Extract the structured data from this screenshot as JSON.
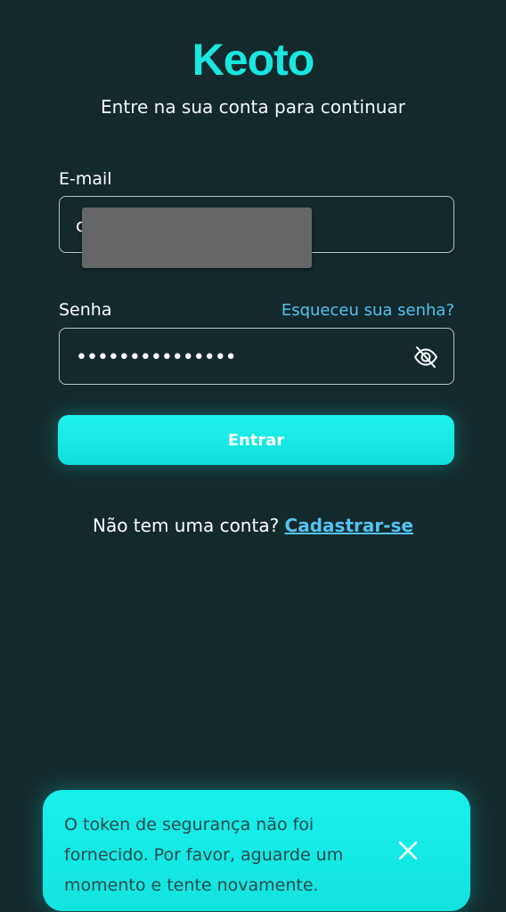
{
  "app": {
    "name": "Keoto",
    "subtitle": "Entre na sua conta para continuar"
  },
  "form": {
    "email_label": "E-mail",
    "email_visible_char": "c",
    "password_label": "Senha",
    "forgot_link": "Esqueceu sua senha?",
    "password_masked": "•••••••••••••••",
    "submit_label": "Entrar"
  },
  "signup": {
    "prompt": "Não tem uma conta?",
    "link": "Cadastrar-se"
  },
  "toast": {
    "message": "O token de segurança não foi fornecido. Por favor, aguarde um momento e tente novamente."
  },
  "icons": {
    "password_toggle": "eye-off-icon",
    "toast_close": "close-icon"
  },
  "colors": {
    "background": "#14292c",
    "accent": "#19e6e0",
    "link": "#52c4f2"
  }
}
